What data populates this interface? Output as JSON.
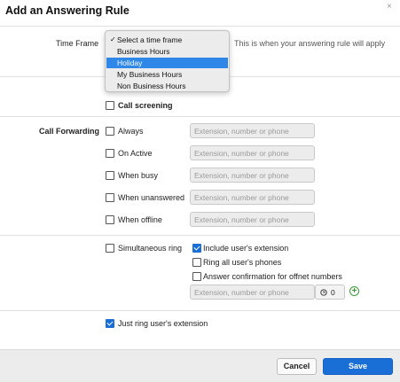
{
  "dialog": {
    "title": "Add an Answering Rule",
    "close_glyph": "×"
  },
  "time_frame": {
    "label": "Time Frame",
    "hint": "This is when your answering rule will apply",
    "options": [
      {
        "label": "Select a time frame",
        "checked": true,
        "highlighted": false
      },
      {
        "label": "Business Hours",
        "checked": false,
        "highlighted": false
      },
      {
        "label": "Holiday",
        "checked": false,
        "highlighted": true
      },
      {
        "label": "My Business Hours",
        "checked": false,
        "highlighted": false
      },
      {
        "label": "Non Business Hours",
        "checked": false,
        "highlighted": false
      }
    ],
    "check_glyph": "✓"
  },
  "call_screening": {
    "label": "Call screening",
    "checked": false
  },
  "call_forwarding": {
    "label": "Call Forwarding",
    "placeholder": "Extension, number or phone",
    "options": [
      {
        "label": "Always",
        "checked": false
      },
      {
        "label": "On Active",
        "checked": false
      },
      {
        "label": "When busy",
        "checked": false
      },
      {
        "label": "When unanswered",
        "checked": false
      },
      {
        "label": "When offline",
        "checked": false
      }
    ]
  },
  "simultaneous": {
    "label": "Simultaneous ring",
    "checked": false,
    "include_ext": {
      "label": "Include user's extension",
      "checked": true
    },
    "ring_all": {
      "label": "Ring all user's phones",
      "checked": false
    },
    "answer_confirm": {
      "label": "Answer confirmation for offnet numbers",
      "checked": false
    },
    "placeholder": "Extension, number or phone",
    "timer_value": "0",
    "clock_icon": "clock-icon",
    "add_icon": "plus-circle-icon"
  },
  "just_ring": {
    "label": "Just ring user's extension",
    "checked": true
  },
  "footer": {
    "cancel_label": "Cancel",
    "save_label": "Save"
  },
  "colors": {
    "accent": "#1a6fd6",
    "highlight": "#2f88e8",
    "add_green": "#3a9a3a"
  }
}
